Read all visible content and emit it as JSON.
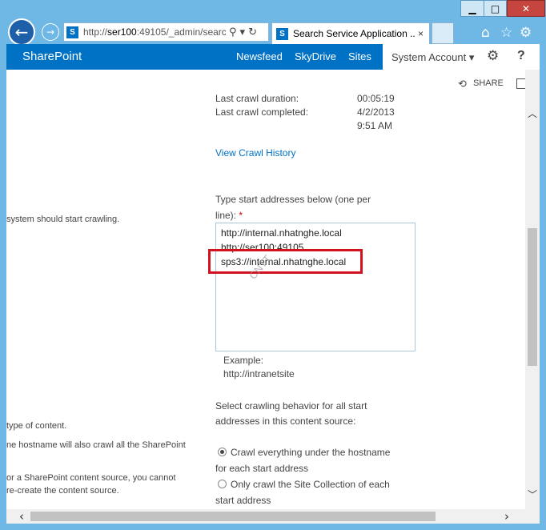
{
  "window": {
    "min_glyph": "▁",
    "max_glyph": "□",
    "close_glyph": "✕"
  },
  "toolbar": {
    "back_glyph": "←",
    "forward_glyph": "→",
    "address_prefix": "http://",
    "address_host": "ser100",
    "address_rest": ":49105/_admin/searc",
    "search_glyph": "⚲",
    "dropdown_glyph": "▾",
    "refresh_glyph": "↻",
    "tab_label": "Search Service Application ...",
    "tab_close": "×",
    "favicon_letter": "S",
    "home_glyph": "⌂",
    "star_glyph": "☆",
    "gear_glyph": "⚙"
  },
  "sharepoint": {
    "brand": "SharePoint",
    "nav": [
      "Newsfeed",
      "SkyDrive",
      "Sites"
    ],
    "account": "System Account ▾",
    "gear_glyph": "⚙",
    "help": "?",
    "share": "SHARE",
    "share_glyph": "⟲"
  },
  "content": {
    "last_crawl_duration_label": "Last crawl duration:",
    "last_crawl_duration_value": "00:05:19",
    "last_crawl_completed_label": "Last crawl completed:",
    "last_crawl_completed_date": "4/2/2013",
    "last_crawl_completed_time": "9:51 AM",
    "view_crawl_history": "View Crawl History",
    "start_addresses_label_1": "Type start addresses below (one per",
    "start_addresses_label_2": "line):",
    "required_mark": "*",
    "start_addresses": [
      "http://internal.nhatnghe.local",
      "http://ser100:49105",
      "sps3://internal.nhatnghe.local"
    ],
    "watermark": "CNTT",
    "example_label": "Example:",
    "example_value": "http://intranetsite",
    "behavior_label_1": "Select crawling behavior for all start",
    "behavior_label_2": "addresses in this content source:",
    "option_1_line_1": "Crawl everything under the hostname",
    "option_1_line_2": "for each start address",
    "option_2_line_1": "Only crawl the Site Collection of each",
    "option_2_line_2": "start address",
    "left_text_1": "system should start crawling.",
    "left_text_2": "type of content.",
    "left_text_3": "ne hostname will also crawl all the SharePoint",
    "left_text_4": "or a SharePoint content source, you cannot",
    "left_text_5": "re-create the content source."
  },
  "scroll": {
    "up": "︿",
    "down": "﹀",
    "left": "‹",
    "right": "›"
  }
}
